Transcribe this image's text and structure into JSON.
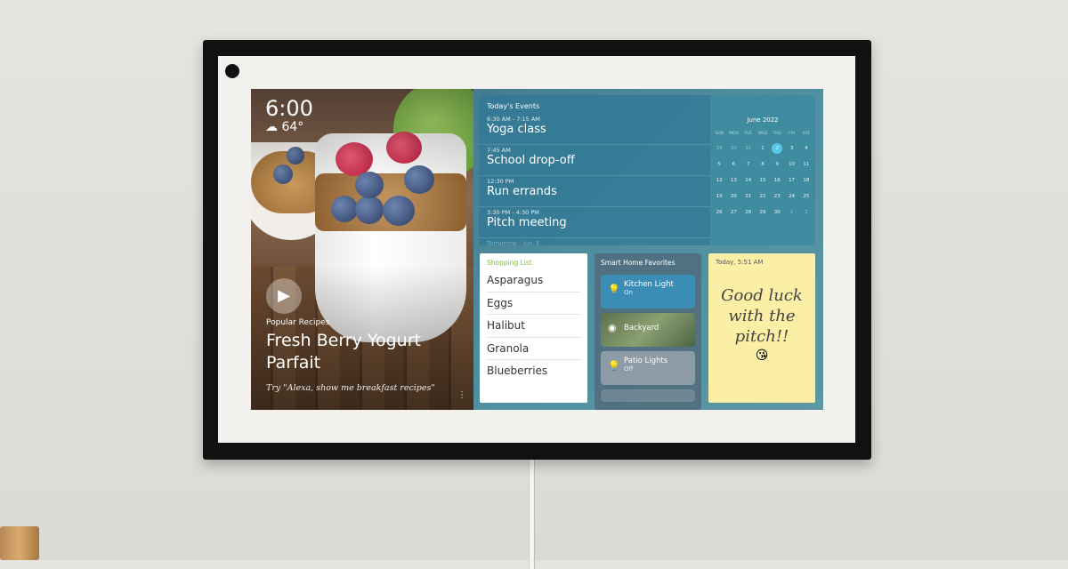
{
  "clock": {
    "time": "6:00",
    "weather_icon": "partly-cloudy-icon",
    "temperature": "64°"
  },
  "recipe": {
    "category": "Popular Recipes",
    "title": "Fresh Berry Yogurt Parfait",
    "hint": "Try \"Alexa, show me breakfast recipes\"",
    "play_icon": "play-icon",
    "more_icon": "more-vertical-icon"
  },
  "events": {
    "header": "Today's Events",
    "items": [
      {
        "time": "6:30 AM - 7:15 AM",
        "name": "Yoga class"
      },
      {
        "time": "7:45 AM",
        "name": "School drop-off"
      },
      {
        "time": "12:30 PM",
        "name": "Run errands"
      },
      {
        "time": "3:30 PM - 4:30 PM",
        "name": "Pitch meeting"
      }
    ],
    "tomorrow": "Tomorrow - Jun 3"
  },
  "calendar": {
    "month": "June 2022",
    "days_of_week": [
      "SUN",
      "MON",
      "TUE",
      "WED",
      "THU",
      "FRI",
      "SAT"
    ],
    "days": [
      "29",
      "30",
      "31",
      "1",
      "2",
      "3",
      "4",
      "5",
      "6",
      "7",
      "8",
      "9",
      "10",
      "11",
      "12",
      "13",
      "14",
      "15",
      "16",
      "17",
      "18",
      "19",
      "20",
      "21",
      "22",
      "23",
      "24",
      "25",
      "26",
      "27",
      "28",
      "29",
      "30",
      "1",
      "2"
    ],
    "today": "2",
    "today_color": "#58c7e8"
  },
  "shopping": {
    "header": "Shopping List",
    "items": [
      "Asparagus",
      "Eggs",
      "Halibut",
      "Granola",
      "Blueberries"
    ],
    "accent": "#7fbf3a"
  },
  "smart_home": {
    "header": "Smart Home Favorites",
    "devices": [
      {
        "name": "Kitchen Light",
        "state": "On",
        "icon": "light-bulb-icon",
        "color": "#3b8db5"
      },
      {
        "name": "Backyard",
        "state": "",
        "icon": "camera-icon"
      },
      {
        "name": "Patio Lights",
        "state": "Off",
        "icon": "light-bulb-icon",
        "color": "#8c9ba6"
      }
    ]
  },
  "note": {
    "timestamp": "Today, 5:51 AM",
    "text": "Good luck with the pitch!!",
    "emoji": "😘",
    "color": "#fbefa6"
  }
}
